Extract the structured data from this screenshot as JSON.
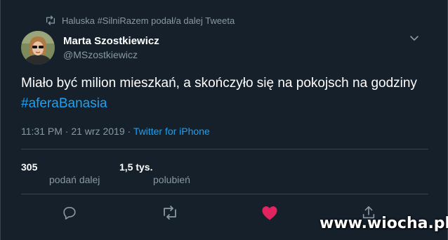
{
  "retweet_context": {
    "text": "Haluska #SilniRazem podał/a dalej Tweeta",
    "icon": "retweet-icon"
  },
  "author": {
    "name": "Marta Szostkiewicz",
    "handle": "@MSzostkiewicz",
    "avatar_icon": "avatar"
  },
  "tweet": {
    "text_main": "Miało być milion mieszkań, a skończyło się na pokojsch na godziny ",
    "hashtag": "#aferaBanasia"
  },
  "meta": {
    "time": "11:31 PM",
    "sep1": " · ",
    "date": "21 wrz 2019",
    "sep2": " · ",
    "source": "Twitter for iPhone"
  },
  "stats": {
    "retweets_count": "305",
    "retweets_label": "podań dalej",
    "likes_count": "1,5 tys.",
    "likes_label": "polubień"
  },
  "actions": [
    "reply-icon",
    "retweet-icon",
    "like-icon",
    "share-icon"
  ],
  "colors": {
    "background": "#15202b",
    "secondary_text": "#8899a6",
    "link": "#1da1f2",
    "like": "#e0245e",
    "divider": "#38444d"
  },
  "watermark": {
    "text": "www.wiocha.pl"
  }
}
